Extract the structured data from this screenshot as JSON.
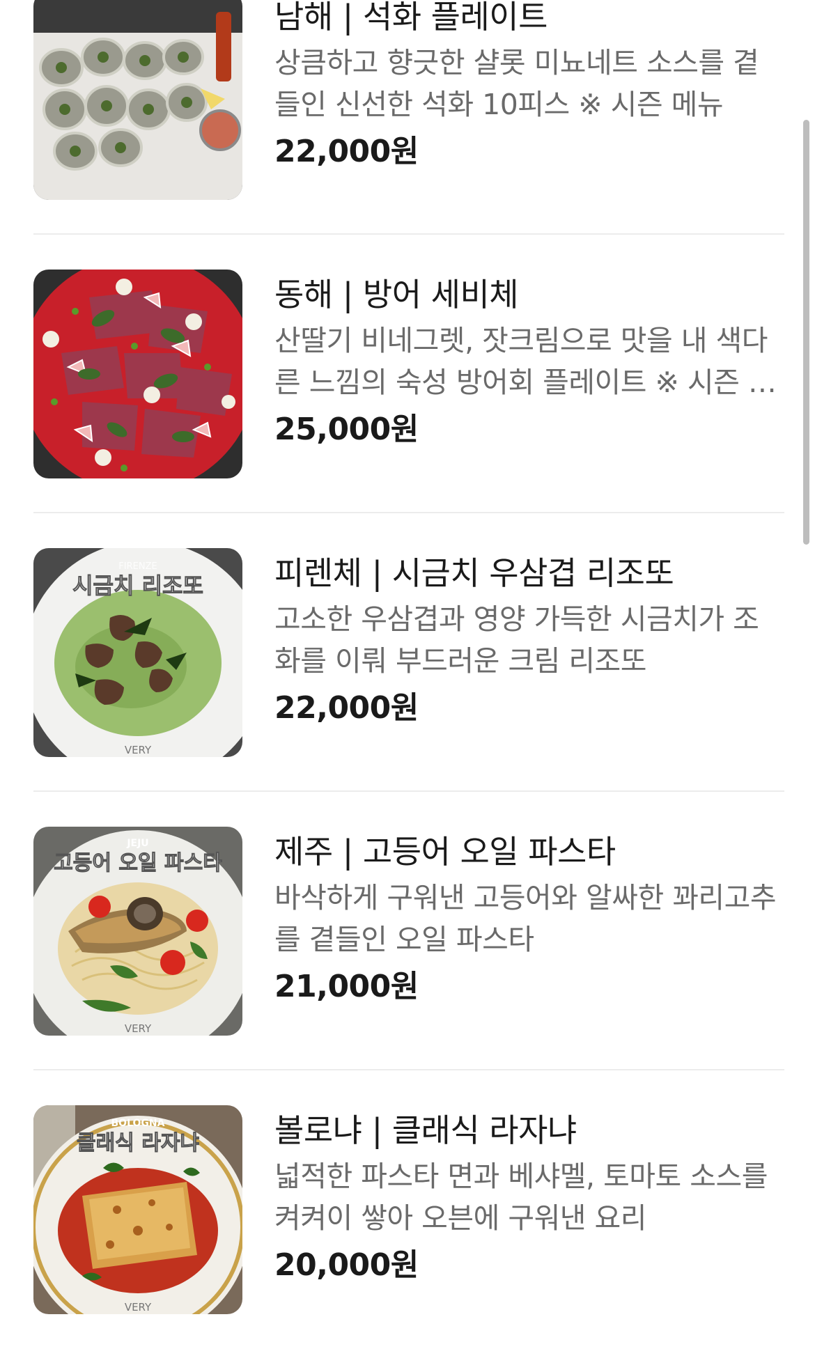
{
  "menu": {
    "items": [
      {
        "name": "남해 | 석화 플레이트",
        "description": "상큼하고 향긋한 샬롯 미뇨네트 소스를 곁들인 신선한 석화 10피스 ※ 시즌 메뉴",
        "price": "22,000원",
        "image_icon": "oyster-plate-photo"
      },
      {
        "name": "동해 | 방어 세비체",
        "description": "산딸기 비네그렛, 잣크림으로 맛을 내 색다른 느낌의 숙성 방어회 플레이트 ※ 시즌 …",
        "price": "25,000원",
        "image_icon": "yellowtail-ceviche-photo"
      },
      {
        "name": "피렌체 | 시금치 우삼겹 리조또",
        "description": "고소한 우삼겹과 영양 가득한 시금치가 조화를 이뤄 부드러운 크림 리조또",
        "price": "22,000원",
        "image_icon": "spinach-risotto-photo",
        "image_overlay": {
          "sub": "FIRENZE",
          "title": "시금치 리조또",
          "footer": "VERY"
        }
      },
      {
        "name": "제주 | 고등어 오일 파스타",
        "description": "바삭하게 구워낸 고등어와 알싸한 꽈리고추를 곁들인 오일 파스타",
        "price": "21,000원",
        "image_icon": "mackerel-pasta-photo",
        "image_overlay": {
          "sub": "JEJU",
          "title": "고등어 오일 파스타",
          "footer": "VERY"
        }
      },
      {
        "name": "볼로냐 | 클래식 라자냐",
        "description": "넓적한 파스타 면과 베샤멜, 토마토 소스를 켜켜이 쌓아 오븐에 구워낸 요리",
        "price": "20,000원",
        "image_icon": "lasagna-photo",
        "image_overlay": {
          "sub": "BOLOGNA",
          "title": "클래식 라자냐",
          "footer": "VERY"
        }
      }
    ]
  },
  "colors": {
    "name_text": "#1a1a1a",
    "desc_text": "#6a6a6a",
    "divider": "#ececec",
    "scrollbar": "#bdbdbd"
  }
}
